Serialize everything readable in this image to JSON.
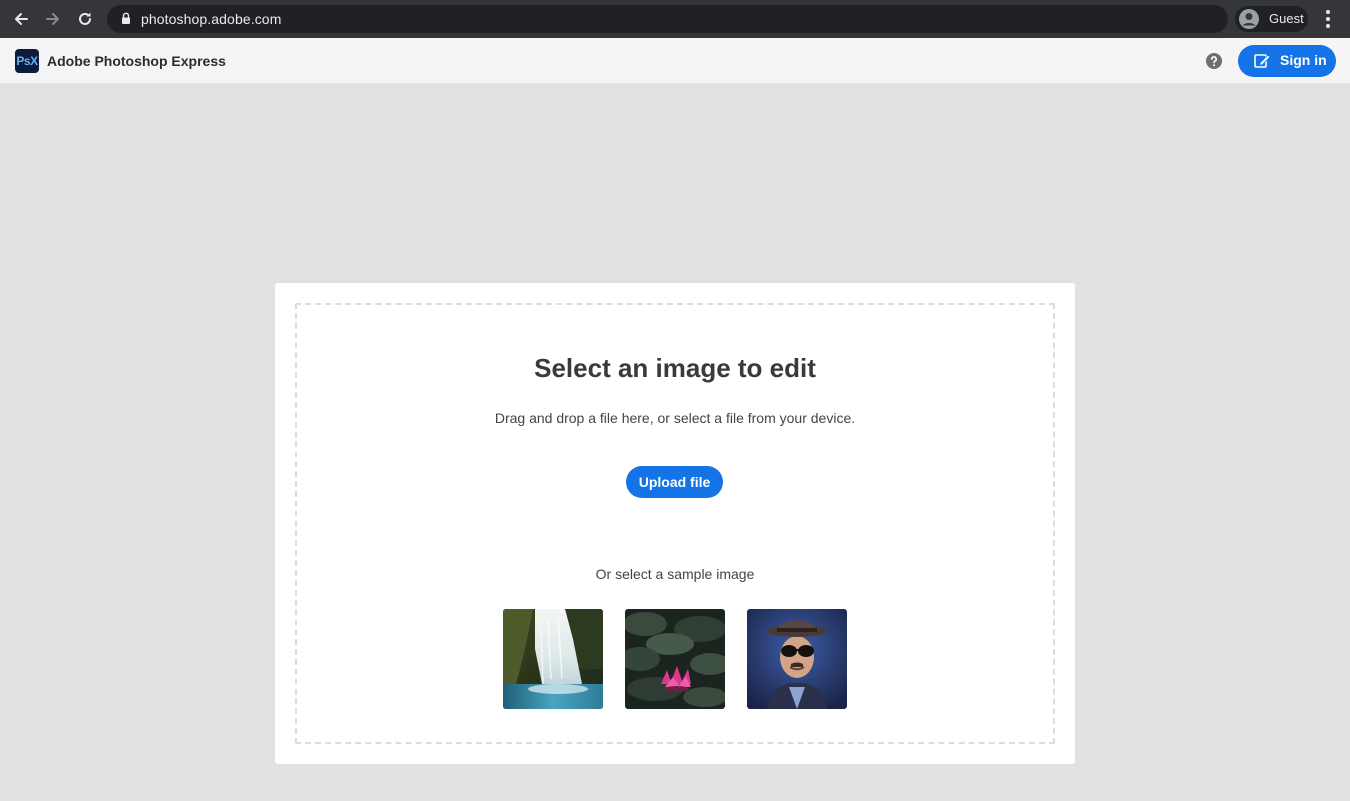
{
  "browser": {
    "url": "photoshop.adobe.com",
    "profile_label": "Guest",
    "icons": {
      "back": "back-arrow-icon",
      "forward": "forward-arrow-icon",
      "reload": "reload-icon",
      "lock": "lock-icon",
      "avatar": "avatar-icon",
      "menu": "kebab-menu-icon"
    }
  },
  "header": {
    "logo_text": "PsX",
    "app_name": "Adobe Photoshop Express",
    "sign_in_label": "Sign in",
    "icons": {
      "help": "help-icon",
      "sign_in": "sign-in-icon"
    }
  },
  "main": {
    "title": "Select an image to edit",
    "description": "Drag and drop a file here, or select a file from your device.",
    "upload_label": "Upload file",
    "sample_label": "Or select a sample image",
    "samples": [
      "waterfall",
      "water-lily",
      "man-with-hat-and-sunglasses"
    ]
  },
  "colors": {
    "accent": "#1473e6",
    "browser_bar": "#35363a",
    "page_background": "#e1e1e1"
  }
}
